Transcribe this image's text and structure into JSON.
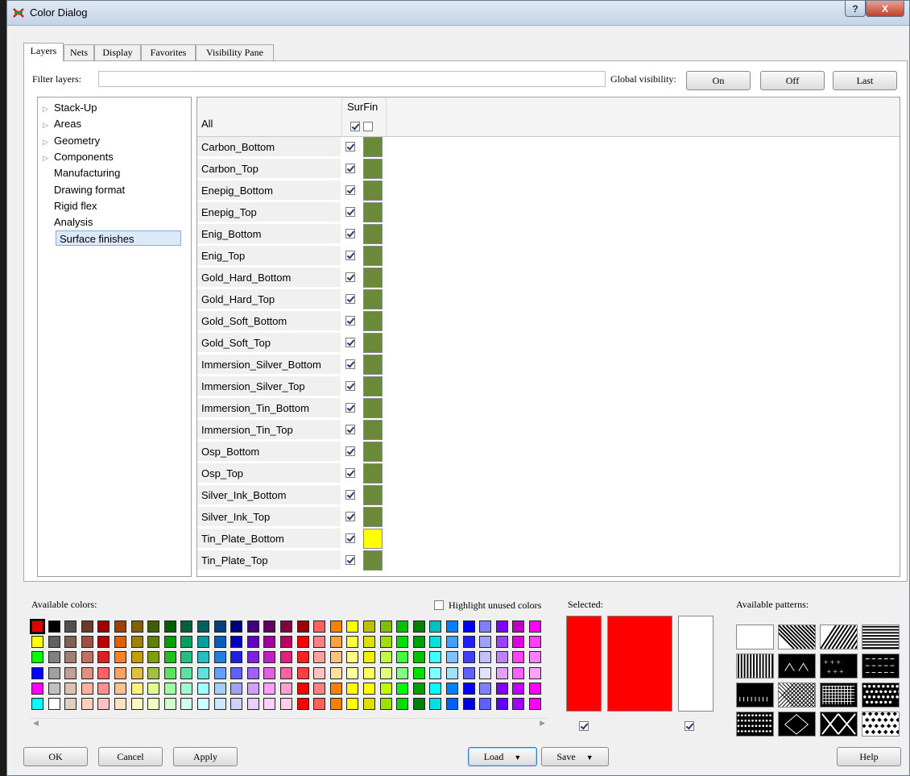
{
  "window": {
    "title": "Color Dialog",
    "help_glyph": "?",
    "close_glyph": "X"
  },
  "tabs": [
    "Layers",
    "Nets",
    "Display",
    "Favorites",
    "Visibility Pane"
  ],
  "filter": {
    "label": "Filter layers:",
    "value": "",
    "placeholder": ""
  },
  "global_visibility": {
    "label": "Global visibility:",
    "on": "On",
    "off": "Off",
    "last": "Last"
  },
  "tree": [
    {
      "label": "Stack-Up",
      "expandable": true
    },
    {
      "label": "Areas",
      "expandable": true
    },
    {
      "label": "Geometry",
      "expandable": true
    },
    {
      "label": "Components",
      "expandable": true
    },
    {
      "label": "Manufacturing",
      "expandable": false
    },
    {
      "label": "Drawing format",
      "expandable": false
    },
    {
      "label": "Rigid flex",
      "expandable": false
    },
    {
      "label": "Analysis",
      "expandable": false
    },
    {
      "label": "Surface finishes",
      "expandable": false,
      "selected": true
    }
  ],
  "grid": {
    "column": "SurFin",
    "all_label": "All",
    "rows": [
      {
        "name": "Carbon_Bottom",
        "checked": true,
        "color": "#6a8a3a"
      },
      {
        "name": "Carbon_Top",
        "checked": true,
        "color": "#6a8a3a"
      },
      {
        "name": "Enepig_Bottom",
        "checked": true,
        "color": "#6a8a3a"
      },
      {
        "name": "Enepig_Top",
        "checked": true,
        "color": "#6a8a3a"
      },
      {
        "name": "Enig_Bottom",
        "checked": true,
        "color": "#6a8a3a"
      },
      {
        "name": "Enig_Top",
        "checked": true,
        "color": "#6a8a3a"
      },
      {
        "name": "Gold_Hard_Bottom",
        "checked": true,
        "color": "#6a8a3a"
      },
      {
        "name": "Gold_Hard_Top",
        "checked": true,
        "color": "#6a8a3a"
      },
      {
        "name": "Gold_Soft_Bottom",
        "checked": true,
        "color": "#6a8a3a"
      },
      {
        "name": "Gold_Soft_Top",
        "checked": true,
        "color": "#6a8a3a"
      },
      {
        "name": "Immersion_Silver_Bottom",
        "checked": true,
        "color": "#6a8a3a"
      },
      {
        "name": "Immersion_Silver_Top",
        "checked": true,
        "color": "#6a8a3a"
      },
      {
        "name": "Immersion_Tin_Bottom",
        "checked": true,
        "color": "#6a8a3a"
      },
      {
        "name": "Immersion_Tin_Top",
        "checked": true,
        "color": "#6a8a3a"
      },
      {
        "name": "Osp_Bottom",
        "checked": true,
        "color": "#6a8a3a"
      },
      {
        "name": "Osp_Top",
        "checked": true,
        "color": "#6a8a3a"
      },
      {
        "name": "Silver_Ink_Bottom",
        "checked": true,
        "color": "#6a8a3a"
      },
      {
        "name": "Silver_Ink_Top",
        "checked": true,
        "color": "#6a8a3a"
      },
      {
        "name": "Tin_Plate_Bottom",
        "checked": true,
        "color": "#ffff00"
      },
      {
        "name": "Tin_Plate_Top",
        "checked": true,
        "color": "#6a8a3a"
      }
    ]
  },
  "colors": {
    "label": "Available colors:",
    "highlight_label": "Highlight unused colors",
    "highlight_checked": false,
    "rows": [
      [
        "#e00000",
        "#000000",
        "#505050",
        "#6b3a2a",
        "#a00000",
        "#a04000",
        "#806000",
        "#406000",
        "#006000",
        "#006040",
        "#006060",
        "#004080",
        "#000080",
        "#400080",
        "#600060",
        "#800040",
        "#a00000",
        "#ff6060",
        "#ff8000",
        "#ffff00",
        "#c0c000",
        "#80c000",
        "#00c000",
        "#008000",
        "#00c0c0",
        "#0080ff",
        "#0000ff",
        "#8080ff",
        "#8000ff",
        "#c000c0",
        "#ff00ff"
      ],
      [
        "#ffff00",
        "#606060",
        "#806050",
        "#a05040",
        "#c00000",
        "#e06000",
        "#a08000",
        "#608000",
        "#00a000",
        "#00a060",
        "#00a0a0",
        "#0060c0",
        "#0000c0",
        "#6000c0",
        "#a000a0",
        "#c00060",
        "#ff0000",
        "#ff8080",
        "#ffa040",
        "#ffff40",
        "#e0e000",
        "#a0e000",
        "#00e000",
        "#00a000",
        "#00e0e0",
        "#40a0ff",
        "#2020ff",
        "#a0a0ff",
        "#a040ff",
        "#e000e0",
        "#ff40ff"
      ],
      [
        "#00ff00",
        "#808080",
        "#a08070",
        "#c07060",
        "#e02020",
        "#ff8020",
        "#c0a000",
        "#80a000",
        "#20c020",
        "#20c080",
        "#20c0c0",
        "#2080e0",
        "#2020e0",
        "#8020e0",
        "#c020c0",
        "#e02080",
        "#ff2020",
        "#ffa0a0",
        "#ffc080",
        "#ffff80",
        "#f0f000",
        "#c0ff40",
        "#40ff40",
        "#00c000",
        "#40ffff",
        "#80c0ff",
        "#4040ff",
        "#c0c0ff",
        "#c080ff",
        "#ff40ff",
        "#ff80ff"
      ],
      [
        "#0000ff",
        "#a0a0a0",
        "#c0a090",
        "#e09080",
        "#ff6060",
        "#ffa060",
        "#e0c040",
        "#a0c040",
        "#60e060",
        "#60e0a0",
        "#60e0e0",
        "#60a0ff",
        "#6060ff",
        "#a060ff",
        "#e060e0",
        "#ff60a0",
        "#ff4040",
        "#ffc0c0",
        "#ffe0a0",
        "#ffffa0",
        "#ffff60",
        "#e0ff80",
        "#80ff80",
        "#00e000",
        "#80ffff",
        "#a0e0ff",
        "#6060ff",
        "#e0e0ff",
        "#e0a0ff",
        "#ff60ff",
        "#ffa0ff"
      ],
      [
        "#ff00ff",
        "#c0c0c0",
        "#e0c0b0",
        "#ffb0a0",
        "#ff9090",
        "#ffc090",
        "#fff080",
        "#e0ff90",
        "#a0ffa0",
        "#a0ffd0",
        "#a0ffff",
        "#a0d0ff",
        "#a0a0ff",
        "#d0a0ff",
        "#ffa0ff",
        "#ffa0d0",
        "#ff0000",
        "#ff8080",
        "#ff8000",
        "#ffff00",
        "#ffff00",
        "#c0ff00",
        "#00ff00",
        "#00a000",
        "#00ffff",
        "#0080ff",
        "#0000ff",
        "#8080ff",
        "#8000ff",
        "#c000ff",
        "#ff00ff"
      ],
      [
        "#00ffff",
        "#ffffff",
        "#e0d0c0",
        "#ffd0c0",
        "#ffc0c0",
        "#ffe0c0",
        "#fff8c0",
        "#f0ffc0",
        "#d0ffd0",
        "#d0fff0",
        "#d0ffff",
        "#d0e8ff",
        "#d0d0ff",
        "#e8d0ff",
        "#ffd0ff",
        "#ffd0e8",
        "#ff0000",
        "#ff6060",
        "#ff8000",
        "#ffff00",
        "#e0e000",
        "#a0e000",
        "#00e000",
        "#008000",
        "#00e0e0",
        "#0060ff",
        "#0000e0",
        "#6060ff",
        "#6000ff",
        "#a000ff",
        "#ff00ff"
      ]
    ]
  },
  "selected": {
    "label": "Selected:",
    "primary": "#ff0000",
    "secondary": "#ffffff",
    "check1": true,
    "check2": true
  },
  "patterns": {
    "label": "Available patterns:"
  },
  "buttons": {
    "ok": "OK",
    "cancel": "Cancel",
    "apply": "Apply",
    "load": "Load",
    "save": "Save",
    "help": "Help"
  }
}
